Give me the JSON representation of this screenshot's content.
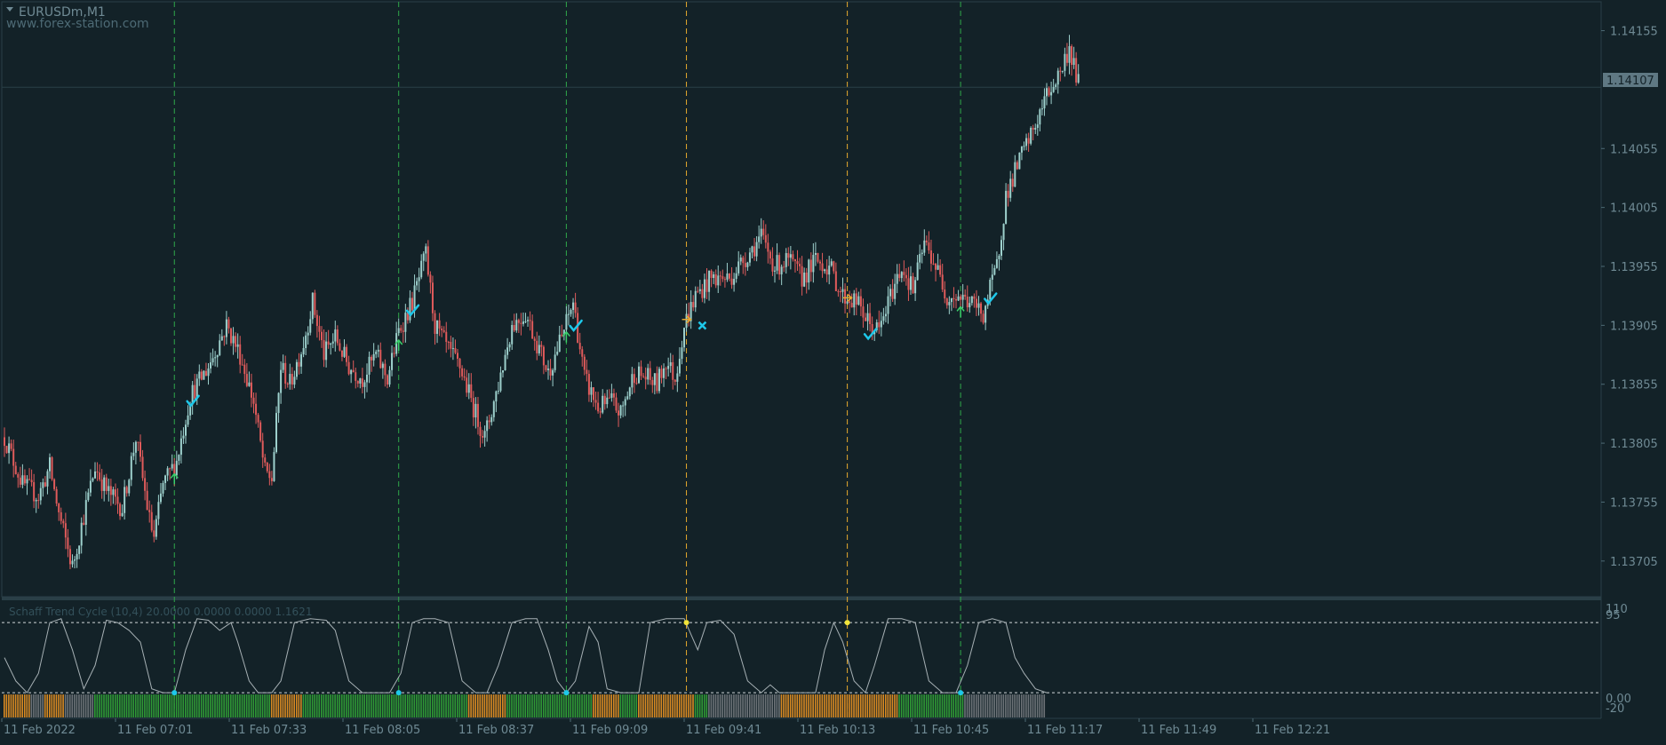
{
  "chart_header": {
    "symbol_timeframe": "EURUSDm,M1",
    "watermark": "www.forex-station.com"
  },
  "current_price": "1.14107",
  "indicator": {
    "label": "Schaff Trend Cycle (10,4)  20.0000 0.0000 0.0000 1.1621",
    "levels": {
      "top": "110",
      "upper": "95",
      "lower": "0.00",
      "zero": "5",
      "bottom": "-20"
    }
  },
  "colors": {
    "background": "#132228",
    "bull_candle": "#9dd0cc",
    "bear_candle": "#e05b5b",
    "buy_line": "#2fa84a",
    "sell_line": "#e5a92e",
    "check_mark": "#1ec8ea",
    "stc_line": "#a6b0b4",
    "bar_green": "#2f9a35",
    "bar_orange": "#d98a22",
    "bar_gray": "#6c7277"
  },
  "chart_data": {
    "type": "candlestick",
    "ylim": [
      1.1368,
      1.14175
    ],
    "y_ticks": [
      1.14155,
      1.14105,
      1.14055,
      1.14005,
      1.13955,
      1.13905,
      1.13855,
      1.13805,
      1.13755,
      1.13705
    ],
    "y_tick_labels": [
      "1.14155",
      "1.14055",
      "1.14005",
      "1.13955",
      "1.13905",
      "1.13855",
      "1.13805",
      "1.13755",
      "1.13705"
    ],
    "x_labels": [
      "11 Feb 2022",
      "11 Feb 07:01",
      "11 Feb 07:33",
      "11 Feb 08:05",
      "11 Feb 08:37",
      "11 Feb 09:09",
      "11 Feb 09:41",
      "11 Feb 10:13",
      "11 Feb 10:45",
      "11 Feb 11:17",
      "11 Feb 11:49",
      "11 Feb 12:21"
    ],
    "price_path": [
      [
        0,
        1.1381
      ],
      [
        8,
        1.1377
      ],
      [
        15,
        1.1376
      ],
      [
        20,
        1.13785
      ],
      [
        24,
        1.13745
      ],
      [
        30,
        1.137
      ],
      [
        34,
        1.13735
      ],
      [
        40,
        1.13785
      ],
      [
        45,
        1.13765
      ],
      [
        52,
        1.1375
      ],
      [
        58,
        1.1381
      ],
      [
        64,
        1.1374
      ],
      [
        66,
        1.13725
      ],
      [
        70,
        1.1377
      ],
      [
        76,
        1.1379
      ],
      [
        82,
        1.13845
      ],
      [
        90,
        1.1387
      ],
      [
        98,
        1.13905
      ],
      [
        104,
        1.1388
      ],
      [
        110,
        1.1384
      ],
      [
        115,
        1.1378
      ],
      [
        118,
        1.13775
      ],
      [
        122,
        1.1387
      ],
      [
        126,
        1.13855
      ],
      [
        132,
        1.1389
      ],
      [
        136,
        1.13925
      ],
      [
        141,
        1.1388
      ],
      [
        146,
        1.13895
      ],
      [
        152,
        1.1387
      ],
      [
        158,
        1.1386
      ],
      [
        164,
        1.1388
      ],
      [
        169,
        1.1386
      ],
      [
        174,
        1.139
      ],
      [
        180,
        1.13925
      ],
      [
        186,
        1.13965
      ],
      [
        190,
        1.13905
      ],
      [
        197,
        1.1388
      ],
      [
        201,
        1.1387
      ],
      [
        208,
        1.1383
      ],
      [
        212,
        1.1381
      ],
      [
        218,
        1.13855
      ],
      [
        224,
        1.13905
      ],
      [
        230,
        1.13915
      ],
      [
        236,
        1.13885
      ],
      [
        240,
        1.13865
      ],
      [
        246,
        1.13895
      ],
      [
        251,
        1.13925
      ],
      [
        256,
        1.1386
      ],
      [
        262,
        1.13835
      ],
      [
        268,
        1.1384
      ],
      [
        272,
        1.1383
      ],
      [
        278,
        1.13865
      ],
      [
        284,
        1.1386
      ],
      [
        288,
        1.13855
      ],
      [
        292,
        1.13875
      ],
      [
        296,
        1.1386
      ],
      [
        300,
        1.13905
      ],
      [
        305,
        1.1393
      ],
      [
        312,
        1.13945
      ],
      [
        320,
        1.13945
      ],
      [
        328,
        1.13965
      ],
      [
        334,
        1.1398
      ],
      [
        340,
        1.13955
      ],
      [
        346,
        1.1396
      ],
      [
        352,
        1.13945
      ],
      [
        358,
        1.1396
      ],
      [
        364,
        1.13955
      ],
      [
        370,
        1.1393
      ],
      [
        376,
        1.13925
      ],
      [
        382,
        1.13905
      ],
      [
        386,
        1.139
      ],
      [
        392,
        1.13935
      ],
      [
        396,
        1.13955
      ],
      [
        401,
        1.13935
      ],
      [
        406,
        1.13975
      ],
      [
        410,
        1.1396
      ],
      [
        416,
        1.1393
      ],
      [
        420,
        1.1393
      ],
      [
        426,
        1.13925
      ],
      [
        432,
        1.13915
      ],
      [
        438,
        1.13955
      ],
      [
        442,
        1.14015
      ],
      [
        448,
        1.14045
      ],
      [
        454,
        1.1407
      ],
      [
        460,
        1.141
      ],
      [
        466,
        1.1412
      ],
      [
        470,
        1.1414
      ],
      [
        474,
        1.1411
      ]
    ],
    "buy_signals": [
      75,
      174,
      248,
      422
    ],
    "sell_signals": [
      301,
      372
    ],
    "check_marks": [
      83,
      180,
      252,
      382,
      435
    ],
    "cross_marks": [
      308
    ],
    "stc": {
      "ylim": [
        -20,
        110
      ],
      "levels": [
        95,
        5
      ],
      "values": [
        [
          0,
          50
        ],
        [
          5,
          20
        ],
        [
          10,
          5
        ],
        [
          15,
          30
        ],
        [
          20,
          95
        ],
        [
          25,
          100
        ],
        [
          30,
          60
        ],
        [
          35,
          10
        ],
        [
          40,
          40
        ],
        [
          45,
          98
        ],
        [
          50,
          95
        ],
        [
          55,
          85
        ],
        [
          60,
          70
        ],
        [
          65,
          10
        ],
        [
          70,
          5
        ],
        [
          75,
          5
        ],
        [
          80,
          60
        ],
        [
          85,
          100
        ],
        [
          90,
          98
        ],
        [
          95,
          85
        ],
        [
          100,
          95
        ],
        [
          103,
          70
        ],
        [
          108,
          20
        ],
        [
          112,
          5
        ],
        [
          118,
          5
        ],
        [
          122,
          20
        ],
        [
          128,
          95
        ],
        [
          135,
          100
        ],
        [
          142,
          98
        ],
        [
          146,
          85
        ],
        [
          152,
          20
        ],
        [
          158,
          5
        ],
        [
          170,
          5
        ],
        [
          175,
          30
        ],
        [
          180,
          95
        ],
        [
          185,
          100
        ],
        [
          190,
          100
        ],
        [
          196,
          95
        ],
        [
          202,
          20
        ],
        [
          208,
          5
        ],
        [
          213,
          5
        ],
        [
          218,
          40
        ],
        [
          224,
          95
        ],
        [
          230,
          100
        ],
        [
          235,
          100
        ],
        [
          240,
          60
        ],
        [
          244,
          20
        ],
        [
          248,
          5
        ],
        [
          252,
          20
        ],
        [
          258,
          90
        ],
        [
          262,
          70
        ],
        [
          266,
          10
        ],
        [
          272,
          5
        ],
        [
          280,
          5
        ],
        [
          285,
          95
        ],
        [
          292,
          100
        ],
        [
          300,
          100
        ],
        [
          303,
          80
        ],
        [
          306,
          60
        ],
        [
          310,
          95
        ],
        [
          316,
          98
        ],
        [
          322,
          80
        ],
        [
          328,
          20
        ],
        [
          334,
          5
        ],
        [
          338,
          15
        ],
        [
          342,
          5
        ],
        [
          350,
          5
        ],
        [
          358,
          5
        ],
        [
          362,
          60
        ],
        [
          366,
          95
        ],
        [
          370,
          70
        ],
        [
          375,
          20
        ],
        [
          380,
          5
        ],
        [
          384,
          40
        ],
        [
          390,
          100
        ],
        [
          396,
          100
        ],
        [
          402,
          95
        ],
        [
          408,
          20
        ],
        [
          414,
          5
        ],
        [
          420,
          5
        ],
        [
          425,
          40
        ],
        [
          430,
          95
        ],
        [
          436,
          100
        ],
        [
          442,
          95
        ],
        [
          446,
          50
        ],
        [
          450,
          30
        ],
        [
          455,
          10
        ],
        [
          460,
          5
        ]
      ]
    },
    "stc_bar_segments": [
      [
        "orange",
        0,
        12
      ],
      [
        "gray",
        12,
        18
      ],
      [
        "orange",
        18,
        27
      ],
      [
        "gray",
        27,
        40
      ],
      [
        "green",
        40,
        118
      ],
      [
        "orange",
        118,
        132
      ],
      [
        "green",
        132,
        205
      ],
      [
        "orange",
        205,
        222
      ],
      [
        "green",
        222,
        260
      ],
      [
        "orange",
        260,
        272
      ],
      [
        "green",
        272,
        280
      ],
      [
        "orange",
        280,
        305
      ],
      [
        "green",
        305,
        311
      ],
      [
        "gray",
        311,
        343
      ],
      [
        "orange",
        343,
        395
      ],
      [
        "green",
        395,
        424
      ],
      [
        "gray",
        424,
        460
      ]
    ]
  }
}
